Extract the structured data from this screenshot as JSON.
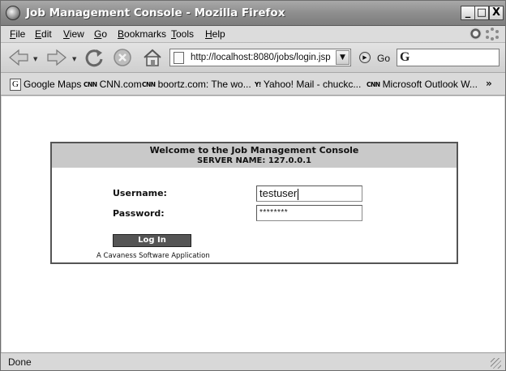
{
  "window": {
    "title": "Job Management Console - Mozilla Firefox",
    "controls": {
      "minimize": "_",
      "maximize": "□",
      "close": "X"
    }
  },
  "menu": {
    "items": [
      {
        "label": "File"
      },
      {
        "label": "Edit"
      },
      {
        "label": "View"
      },
      {
        "label": "Go"
      },
      {
        "label": "Bookmarks"
      },
      {
        "label": "Tools"
      },
      {
        "label": "Help"
      }
    ]
  },
  "navigation": {
    "url": "http://localhost:8080/jobs/login.jsp",
    "go_label": "Go",
    "search_engine": "G",
    "search_value": ""
  },
  "bookmarks": {
    "items": [
      {
        "icon": "G",
        "label": "Google Maps"
      },
      {
        "icon": "CNN",
        "label": "CNN.com"
      },
      {
        "icon": "CNN",
        "label": "boortz.com: The wo..."
      },
      {
        "icon": "Y!",
        "label": "Yahoo! Mail - chuckc..."
      },
      {
        "icon": "CNN",
        "label": "Microsoft Outlook W..."
      }
    ],
    "overflow": "»"
  },
  "page": {
    "title": "Welcome to the Job Management Console",
    "server_name": "SERVER NAME: 127.0.0.1",
    "username_label": "Username:",
    "username_value": "testuser",
    "password_label": "Password:",
    "password_value": "********",
    "login_button": "Log In",
    "footer": "A Cavaness Software Application"
  },
  "status": {
    "text": "Done"
  }
}
